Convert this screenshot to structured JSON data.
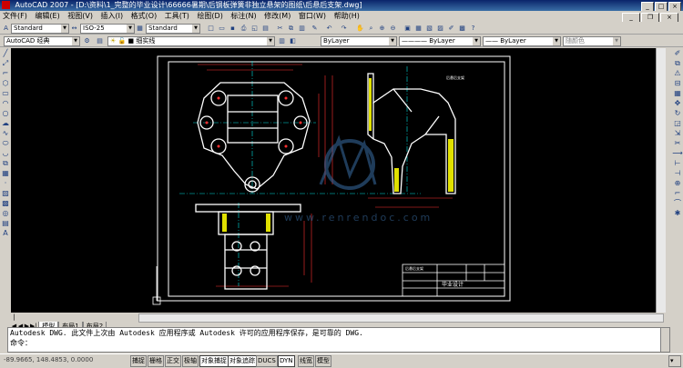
{
  "window": {
    "title": "AutoCAD 2007 - [D:\\资料\\1_完整的毕业设计\\66666暑期\\后钢板弹簧非独立悬架的图纸\\后悬后支架.dwg]"
  },
  "menu": [
    "文件(F)",
    "编辑(E)",
    "视图(V)",
    "插入(I)",
    "格式(O)",
    "工具(T)",
    "绘图(D)",
    "标注(N)",
    "修改(M)",
    "窗口(W)",
    "帮助(H)"
  ],
  "toolbar1": {
    "text_style": "Standard",
    "dim_style": "ISO-25",
    "table_style": "Standard"
  },
  "toolbar2": {
    "workspace": "AutoCAD 经典",
    "layer": "细实线",
    "color": "ByLayer",
    "linetype": "ByLayer",
    "lineweight": "ByLayer",
    "plotstyle": "随颜色"
  },
  "drawing": {
    "label_upper": "后悬后支架",
    "tb_name": "后悬后支架",
    "tb_org": "毕业设计",
    "watermark": "www.renrendoc.com"
  },
  "tabs": {
    "model": "模型",
    "layout1": "布局1",
    "layout2": "布局2"
  },
  "command": {
    "line1": "Autodesk DWG.  此文件上次由 Autodesk 应用程序或 Autodesk 许可的应用程序保存，是可靠的 DWG.",
    "prompt": "命令："
  },
  "status": {
    "coords": "-89.9665, 148.4853, 0.0000",
    "buttons": [
      "捕捉",
      "栅格",
      "正交",
      "极轴",
      "对象捕捉",
      "对象追踪",
      "DUCS",
      "DYN",
      "线宽",
      "模型"
    ]
  },
  "colors": {
    "canvas": "#000000",
    "geometry": "#ffffff",
    "dimension": "#ff3030",
    "centerline": "#00e0e0",
    "hatch": "#e0e000"
  }
}
